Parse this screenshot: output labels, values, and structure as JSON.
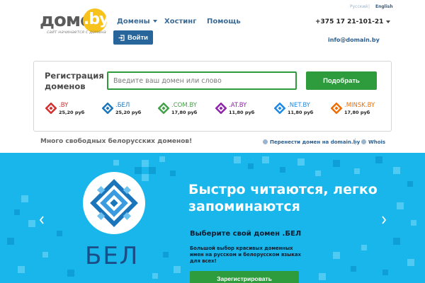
{
  "header": {
    "logo": {
      "word": "домен",
      "suffix": ".by",
      "tagline": "сайт начинается с домена"
    },
    "nav": [
      {
        "label": "Домены",
        "has_dropdown": true
      },
      {
        "label": "Хостинг",
        "has_dropdown": false
      },
      {
        "label": "Помощь",
        "has_dropdown": false
      }
    ],
    "login_label": "Войти",
    "languages": {
      "ru": "Русский",
      "separator": "|",
      "en": "English",
      "active": "English"
    },
    "phone": "+375 17 21-101-21",
    "email": "info@domain.by"
  },
  "registration": {
    "title": "Регистрация доменов",
    "search_placeholder": "Введите ваш домен или слово",
    "search_value": "",
    "search_button": "Подобрать",
    "zones": [
      {
        "name": ".BY",
        "price": "25,20 руб",
        "color": "#d32f2f",
        "icon": "by-emblem-icon"
      },
      {
        "name": ".БЕЛ",
        "price": "25,20 руб",
        "color": "#1b75bb",
        "icon": "bel-emblem-icon"
      },
      {
        "name": ".COM.BY",
        "price": "17,80 руб",
        "color": "#43a047",
        "icon": "com-by-emblem-icon"
      },
      {
        "name": ".AT.BY",
        "price": "11,80 руб",
        "color": "#8e24aa",
        "icon": "at-by-emblem-icon"
      },
      {
        "name": ".NET.BY",
        "price": "11,80 руб",
        "color": "#1e88e5",
        "icon": "net-by-emblem-icon"
      },
      {
        "name": ".MINSK.BY",
        "price": "17,80 руб",
        "color": "#ef6c00",
        "icon": "minsk-by-emblem-icon"
      }
    ]
  },
  "info_strip": {
    "text": "Много свободных белорусских доменов!",
    "transfer_link": "Перенести домен на domain.by",
    "whois_link": "Whois"
  },
  "banner": {
    "badge_label": "БЕЛ",
    "headline": "Быстро читаются, легко запоминаются",
    "sub_title": "Выберите свой домен .БЕЛ",
    "description": "Большой выбор красивых доменных имен на русском и белорусском языках для всех!",
    "cta_label": "Зарегистрировать",
    "colors": {
      "background": "#18b6ea",
      "tile_light": "#4fcaf2",
      "tile_dark": "#0d9fd6",
      "accent": "#2e9b3d"
    }
  }
}
